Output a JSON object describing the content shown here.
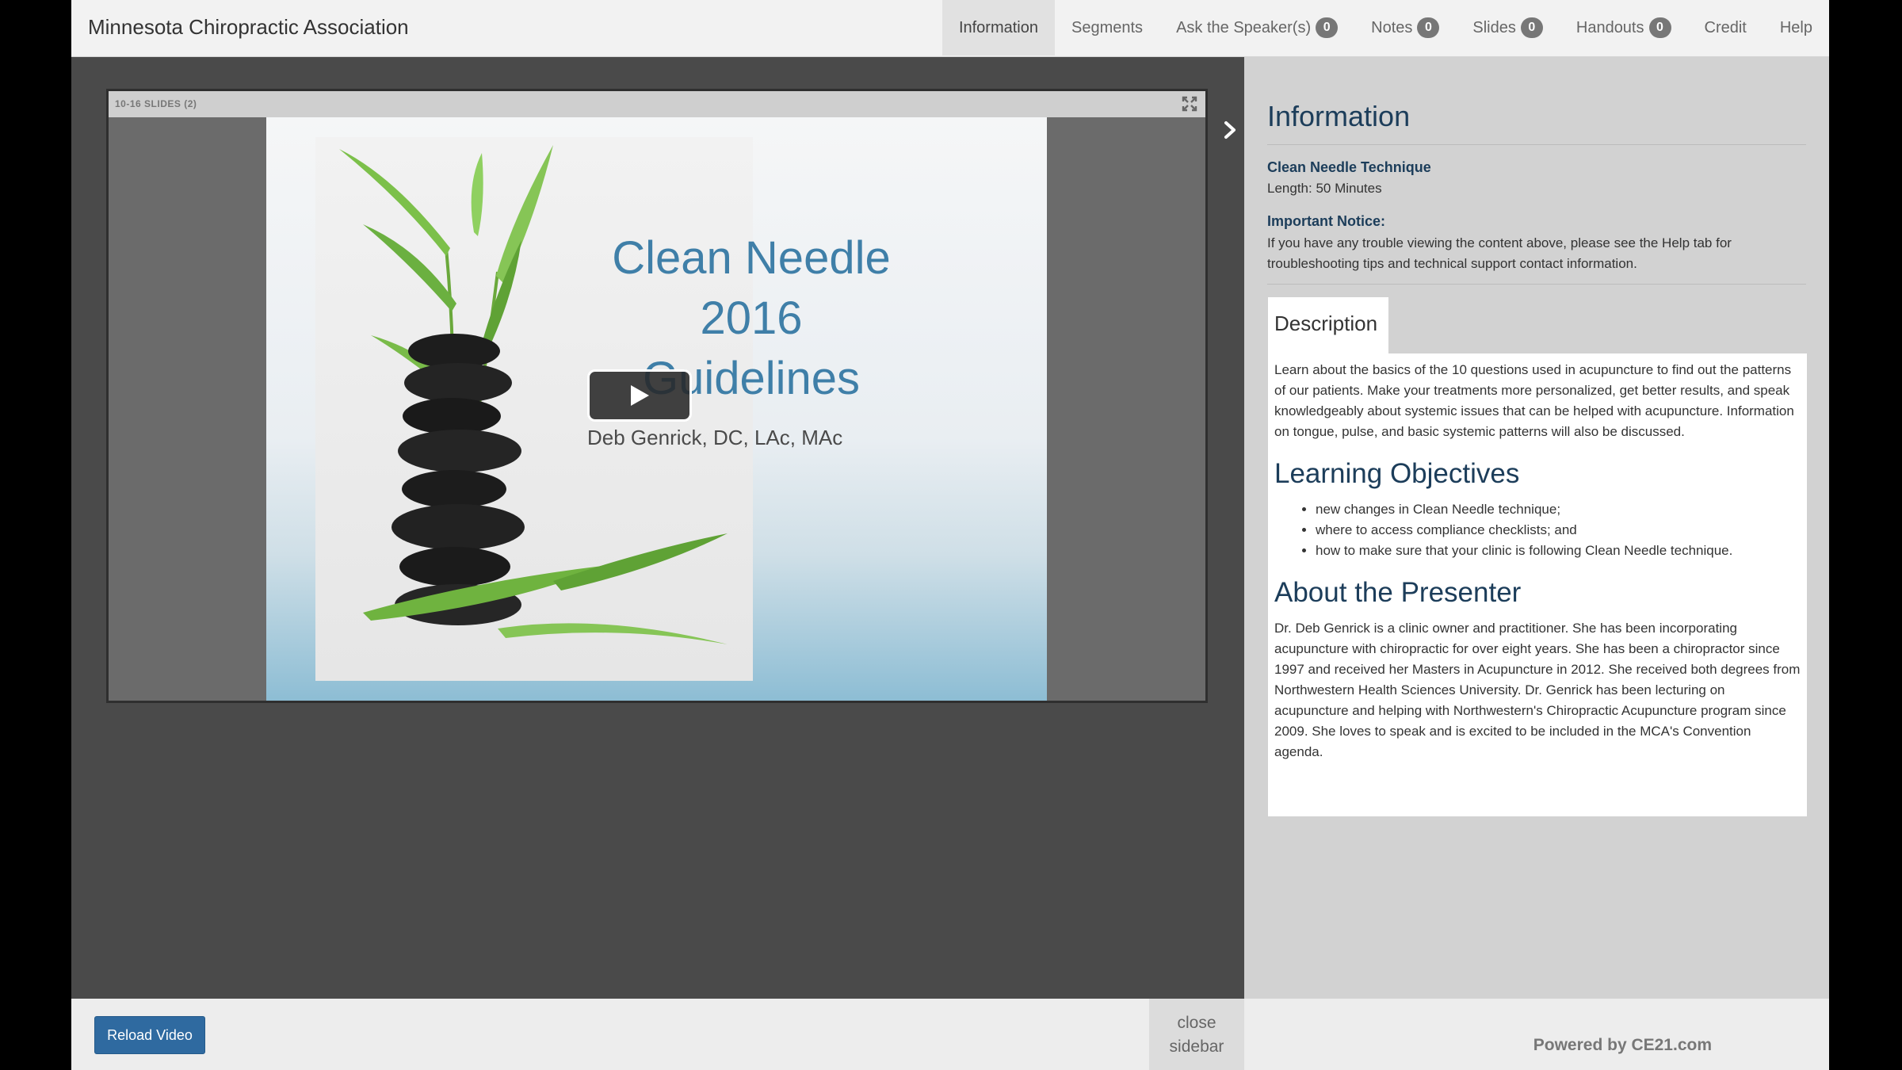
{
  "app": {
    "title": "Minnesota Chiropractic Association"
  },
  "nav": {
    "items": [
      {
        "label": "Information",
        "badge": null
      },
      {
        "label": "Segments",
        "badge": null
      },
      {
        "label": "Ask the Speaker(s)",
        "badge": "0"
      },
      {
        "label": "Notes",
        "badge": "0"
      },
      {
        "label": "Slides",
        "badge": "0"
      },
      {
        "label": "Handouts",
        "badge": "0"
      },
      {
        "label": "Credit",
        "badge": null
      },
      {
        "label": "Help",
        "badge": null
      }
    ],
    "active": "Information"
  },
  "player": {
    "bar_title": "10-16 SLIDES (2)",
    "slide": {
      "title_lines": [
        "Clean Needle",
        "2016",
        "Guidelines"
      ],
      "presenter": "Deb Genrick, DC, LAc, MAc"
    },
    "icons": {
      "play": "play-icon",
      "expand": "expand-icon",
      "toggle": "chevron-right-icon"
    }
  },
  "sidebar": {
    "title": "Information",
    "course_title": "Clean Needle Technique",
    "length": "Length: 50 Minutes",
    "notice_label": "Important Notice:",
    "notice_text": "If you have any trouble viewing the content above, please see the Help tab for troubleshooting tips and technical support contact information.",
    "description_tab": "Description",
    "description": "Learn about the basics of the 10 questions used in acupuncture to find out the patterns of our patients. Make your treatments more personalized, get better results, and speak knowledgeably about systemic issues that can be helped with acupuncture. Information on tongue, pulse, and basic systemic patterns will also be discussed.",
    "objectives_heading": "Learning Objectives",
    "objectives": [
      "new changes in Clean Needle technique;",
      "where to access compliance checklists; and",
      "how to make sure that your clinic is following Clean Needle technique."
    ],
    "presenter_heading": "About the Presenter",
    "presenter_text": "Dr. Deb Genrick is a clinic owner and practitioner. She has been incorporating acupuncture with chiropractic for over eight years. She has been a chiropractor since 1997 and received her Masters in Acupuncture in 2012. She received both degrees from Northwestern Health Sciences University. Dr. Genrick has been lecturing on acupuncture and helping with Northwestern's Chiropractic Acupuncture program since 2009. She loves to speak and is excited to be included in the MCA's Convention agenda."
  },
  "footer": {
    "reload_label": "Reload Video",
    "close_sidebar_line1": "close",
    "close_sidebar_line2": "sidebar",
    "powered_by": "Powered by CE21.com"
  },
  "colors": {
    "accent": "#2f6aa0",
    "heading": "#1c3d5a",
    "slide_title": "#3f7fa8"
  }
}
